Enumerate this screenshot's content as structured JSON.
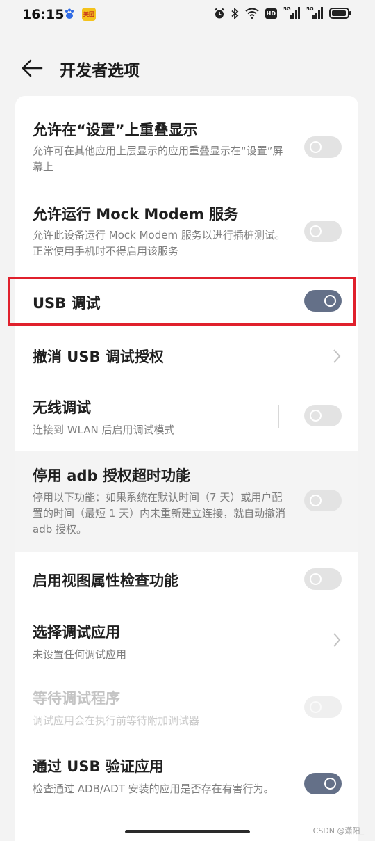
{
  "status_bar": {
    "time": "16:15",
    "app_badge_text": "美团",
    "hd_label": "HD",
    "signal1_label": "5G",
    "signal2_label": "5G",
    "icons": [
      "baidu-paw-icon",
      "meituan-app-icon",
      "alarm-icon",
      "bluetooth-icon",
      "wifi-icon",
      "hd-voice-icon",
      "signal-5g-icon",
      "signal-5g-icon",
      "battery-icon"
    ]
  },
  "header": {
    "title": "开发者选项",
    "back_icon": "arrow-left-icon"
  },
  "settings": [
    {
      "title": "允许在“设置”上重叠显示",
      "subtitle": "允许可在其他应用上层显示的应用重叠显示在“设置”屏幕上",
      "control": "toggle",
      "state": "off"
    },
    {
      "title": "允许运行 Mock Modem 服务",
      "subtitle": "允许此设备运行 Mock Modem 服务以进行插桩测试。正常使用手机时不得启用该服务",
      "control": "toggle",
      "state": "off"
    },
    {
      "title": "USB 调试",
      "control": "toggle",
      "state": "on",
      "highlighted": true
    },
    {
      "title": "撤消 USB 调试授权",
      "control": "chevron"
    },
    {
      "title": "无线调试",
      "subtitle": "连接到 WLAN 后启用调试模式",
      "control": "toggle",
      "state": "off"
    },
    {
      "title": "停用 adb 授权超时功能",
      "subtitle": "停用以下功能：如果系统在默认时间（7 天）或用户配置的时间（最短 1 天）内未重新建立连接，就自动撤消 adb 授权。",
      "control": "toggle",
      "state": "off"
    },
    {
      "title": "启用视图属性检查功能",
      "control": "toggle",
      "state": "off"
    },
    {
      "title": "选择调试应用",
      "subtitle": "未设置任何调试应用",
      "control": "chevron"
    },
    {
      "title": "等待调试程序",
      "subtitle": "调试应用会在执行前等待附加调试器",
      "control": "toggle",
      "state": "disabled"
    },
    {
      "title": "通过 USB 验证应用",
      "subtitle": "检查通过 ADB/ADT 安装的应用是否存在有害行为。",
      "control": "toggle",
      "state": "on"
    }
  ],
  "watermark": "CSDN @潇阳_",
  "colors": {
    "toggle_on": "#647088",
    "toggle_off": "#e3e3e3",
    "highlight_border": "#e0202c"
  }
}
